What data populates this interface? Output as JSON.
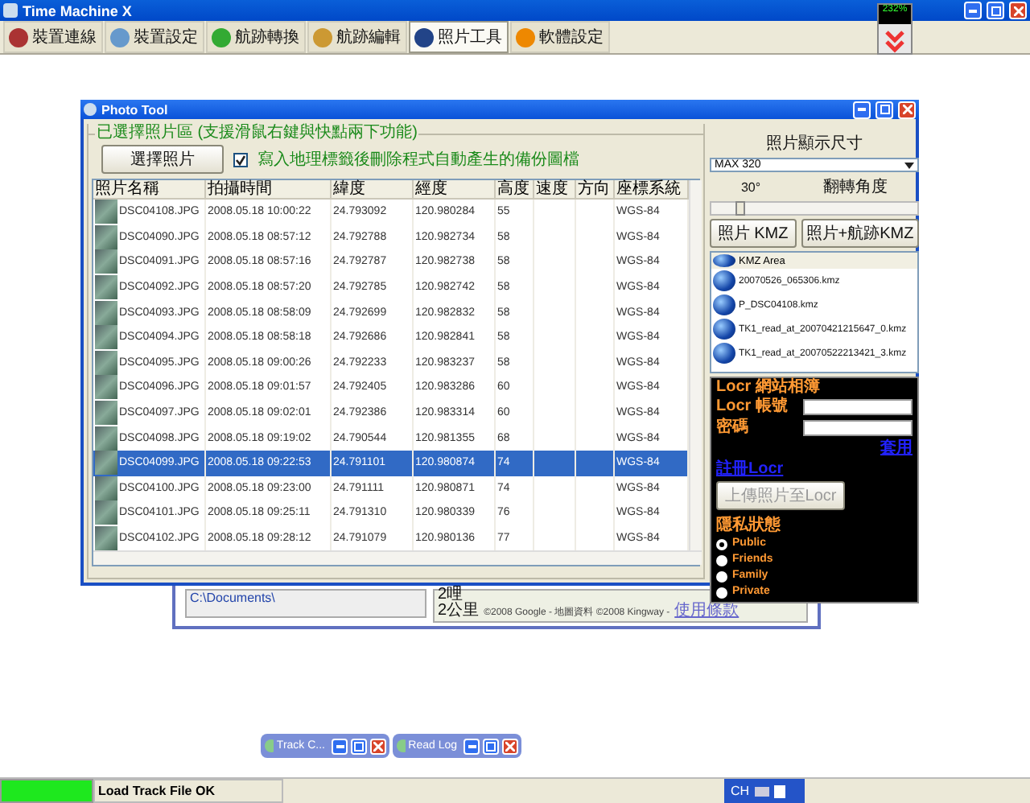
{
  "app": {
    "title": "Time Machine X",
    "indicator": "232%"
  },
  "tabs": [
    {
      "label": "裝置連線",
      "selected": false
    },
    {
      "label": "裝置設定",
      "selected": false
    },
    {
      "label": "航跡轉換",
      "selected": false
    },
    {
      "label": "航跡編輯",
      "selected": false
    },
    {
      "label": "照片工具",
      "selected": true
    },
    {
      "label": "軟體設定",
      "selected": false
    }
  ],
  "photo_tool": {
    "title": "Photo Tool",
    "group_label": "已選擇照片區 (支援滑鼠右鍵與快點兩下功能)",
    "select_button": "選擇照片",
    "checkbox": {
      "label": "寫入地理標籤後刪除程式自動產生的備份圖檔",
      "checked": true
    },
    "table": {
      "columns": [
        "照片名稱",
        "拍攝時間",
        "緯度",
        "經度",
        "高度",
        "速度",
        "方向",
        "座標系統"
      ],
      "rows": [
        {
          "cells": [
            "DSC04108.JPG",
            "2008.05.18 10:00:22",
            "24.793092",
            "120.980284",
            "55",
            "",
            "",
            "WGS-84"
          ],
          "selected": false
        },
        {
          "cells": [
            "DSC04090.JPG",
            "2008.05.18 08:57:12",
            "24.792788",
            "120.982734",
            "58",
            "",
            "",
            "WGS-84"
          ],
          "selected": false
        },
        {
          "cells": [
            "DSC04091.JPG",
            "2008.05.18 08:57:16",
            "24.792787",
            "120.982738",
            "58",
            "",
            "",
            "WGS-84"
          ],
          "selected": false
        },
        {
          "cells": [
            "DSC04092.JPG",
            "2008.05.18 08:57:20",
            "24.792785",
            "120.982742",
            "58",
            "",
            "",
            "WGS-84"
          ],
          "selected": false
        },
        {
          "cells": [
            "DSC04093.JPG",
            "2008.05.18 08:58:09",
            "24.792699",
            "120.982832",
            "58",
            "",
            "",
            "WGS-84"
          ],
          "selected": false
        },
        {
          "cells": [
            "DSC04094.JPG",
            "2008.05.18 08:58:18",
            "24.792686",
            "120.982841",
            "58",
            "",
            "",
            "WGS-84"
          ],
          "selected": false
        },
        {
          "cells": [
            "DSC04095.JPG",
            "2008.05.18 09:00:26",
            "24.792233",
            "120.983237",
            "58",
            "",
            "",
            "WGS-84"
          ],
          "selected": false
        },
        {
          "cells": [
            "DSC04096.JPG",
            "2008.05.18 09:01:57",
            "24.792405",
            "120.983286",
            "60",
            "",
            "",
            "WGS-84"
          ],
          "selected": false
        },
        {
          "cells": [
            "DSC04097.JPG",
            "2008.05.18 09:02:01",
            "24.792386",
            "120.983314",
            "60",
            "",
            "",
            "WGS-84"
          ],
          "selected": false
        },
        {
          "cells": [
            "DSC04098.JPG",
            "2008.05.18 09:19:02",
            "24.790544",
            "120.981355",
            "68",
            "",
            "",
            "WGS-84"
          ],
          "selected": false
        },
        {
          "cells": [
            "DSC04099.JPG",
            "2008.05.18 09:22:53",
            "24.791101",
            "120.980874",
            "74",
            "",
            "",
            "WGS-84"
          ],
          "selected": true
        },
        {
          "cells": [
            "DSC04100.JPG",
            "2008.05.18 09:23:00",
            "24.791111",
            "120.980871",
            "74",
            "",
            "",
            "WGS-84"
          ],
          "selected": false
        },
        {
          "cells": [
            "DSC04101.JPG",
            "2008.05.18 09:25:11",
            "24.791310",
            "120.980339",
            "76",
            "",
            "",
            "WGS-84"
          ],
          "selected": false
        },
        {
          "cells": [
            "DSC04102.JPG",
            "2008.05.18 09:28:12",
            "24.791079",
            "120.980136",
            "77",
            "",
            "",
            "WGS-84"
          ],
          "selected": false
        }
      ]
    },
    "size_panel": {
      "label": "照片顯示尺寸",
      "select_value": "MAX 320",
      "angle_value": "30°",
      "angle_label": "翻轉角度",
      "slider": {
        "level": 0.12
      },
      "buttons": [
        "照片 KMZ",
        "照片+航跡KMZ"
      ]
    },
    "kmz_list": {
      "header": "KMZ Area",
      "items": [
        "20070526_065306.kmz",
        "P_DSC04108.kmz",
        "TK1_read_at_20070421215647_0.kmz",
        "TK1_read_at_20070522213421_3.kmz"
      ]
    },
    "locr": {
      "title": "Locr 網站相簿",
      "account_label": "Locr 帳號",
      "password_label": "密碼",
      "apply_link": "套用",
      "register_link": "註冊Locr",
      "upload_button": {
        "label": "上傳照片至Locr",
        "disabled": true
      },
      "privacy_label": "隱私狀態",
      "options": [
        {
          "label": "Public",
          "selected": true
        },
        {
          "label": "Friends",
          "selected": false
        },
        {
          "label": "Family",
          "selected": false
        },
        {
          "label": "Private",
          "selected": false
        }
      ]
    }
  },
  "map_window": {
    "path_text": "C:\\Documents\\",
    "scale_labels": [
      "2哩",
      "2公里"
    ],
    "copyright": "©2008 Google - 地圖資料 ©2008 Kingway -",
    "terms_link": "使用條款"
  },
  "minimized": [
    {
      "title": "Track C..."
    },
    {
      "title": "Read Log"
    }
  ],
  "status_bar": {
    "progress": {
      "level": 1
    },
    "message": "Load Track File OK",
    "language": "CH"
  }
}
